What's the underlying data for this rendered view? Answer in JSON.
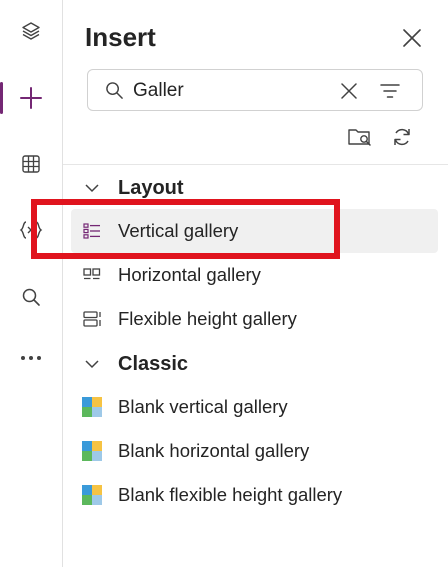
{
  "rail": {
    "items": [
      {
        "icon": "layers-icon"
      },
      {
        "icon": "plus-icon",
        "active": true
      },
      {
        "icon": "table-icon"
      },
      {
        "icon": "variables-icon"
      },
      {
        "icon": "search-icon"
      },
      {
        "icon": "more-icon"
      }
    ]
  },
  "panel": {
    "title": "Insert",
    "search": {
      "value": "Galler",
      "placeholder": ""
    },
    "groups": [
      {
        "label": "Layout",
        "items": [
          {
            "label": "Vertical gallery",
            "icon": "vertical-gallery-icon",
            "selected": true
          },
          {
            "label": "Horizontal gallery",
            "icon": "horizontal-gallery-icon"
          },
          {
            "label": "Flexible height gallery",
            "icon": "flexible-height-gallery-icon"
          }
        ]
      },
      {
        "label": "Classic",
        "items": [
          {
            "label": "Blank vertical gallery",
            "icon": "classic-gallery-icon"
          },
          {
            "label": "Blank horizontal gallery",
            "icon": "classic-gallery-icon"
          },
          {
            "label": "Blank flexible height gallery",
            "icon": "classic-gallery-icon"
          }
        ]
      }
    ]
  },
  "colors": {
    "accent": "#742774",
    "highlight": "#e0141e"
  }
}
